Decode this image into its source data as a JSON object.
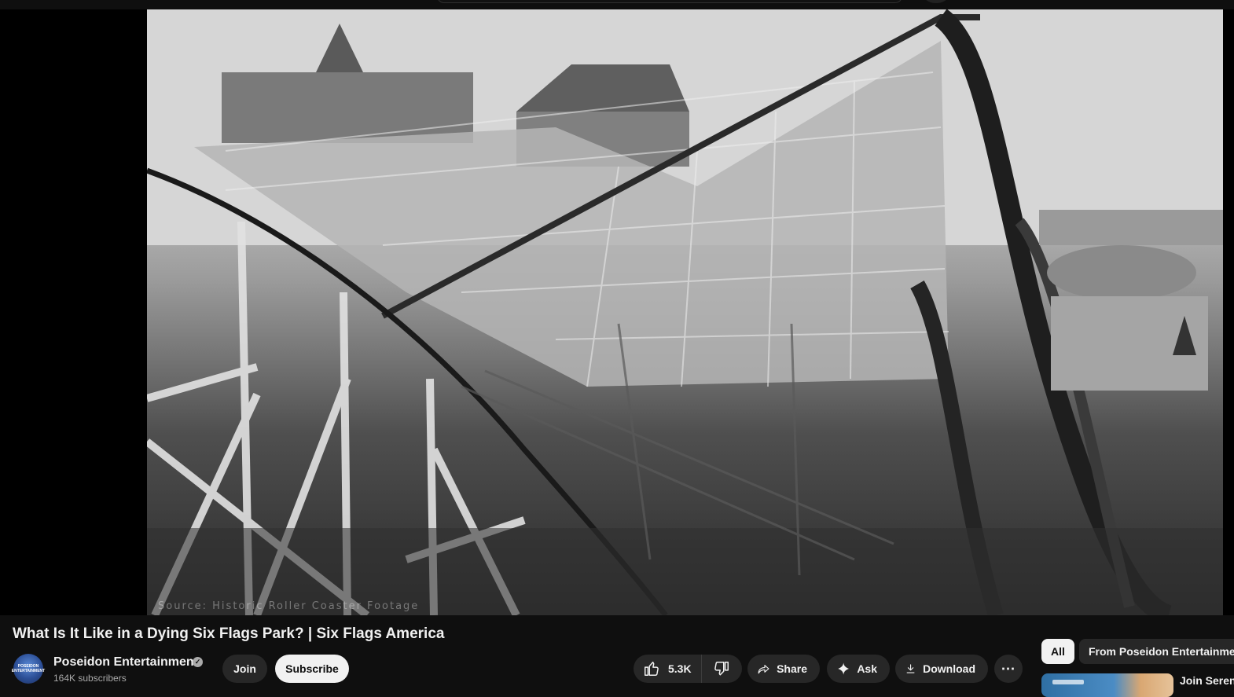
{
  "video": {
    "title": "What Is It Like in a Dying Six Flags Park? | Six Flags America",
    "watermark": "Source: Historic Roller Coaster Footage"
  },
  "channel": {
    "name": "Poseidon Entertainment",
    "subscribers": "164K subscribers",
    "avatar_text": "POSEIDON ENTERTAINMENT",
    "verified_icon": "check-circle-icon"
  },
  "buttons": {
    "join": "Join",
    "subscribe": "Subscribe"
  },
  "actions": {
    "like_count": "5.3K",
    "share": "Share",
    "ask": "Ask",
    "download": "Download",
    "more": "⋯"
  },
  "sidebar": {
    "chips": [
      "All",
      "From Poseidon Entertainment"
    ],
    "rec_title": "Join Seren"
  },
  "colors": {
    "background": "#0f0f0f",
    "button_bg": "#272727",
    "subscribe_bg": "#f1f1f1",
    "text_primary": "#f1f1f1",
    "text_secondary": "#aaaaaa"
  }
}
